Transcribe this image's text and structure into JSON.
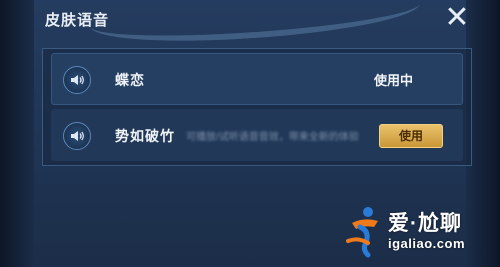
{
  "dialog": {
    "title": "皮肤语音",
    "close_icon": "close-icon",
    "close_label": "✕"
  },
  "voices": [
    {
      "name": "蝶恋",
      "status": "使用中",
      "icon": "speaker-icon"
    },
    {
      "name": "势如破竹",
      "description": "可播放/试听语音音效，带来全新的体验",
      "button_label": "使用",
      "icon": "speaker-icon"
    }
  ],
  "watermark": {
    "text": "爱·尬聊",
    "url": "igaliao.com"
  },
  "colors": {
    "panel": "#243c5f",
    "accent_gold": "#d9ad52",
    "text": "#f0f3f8"
  }
}
